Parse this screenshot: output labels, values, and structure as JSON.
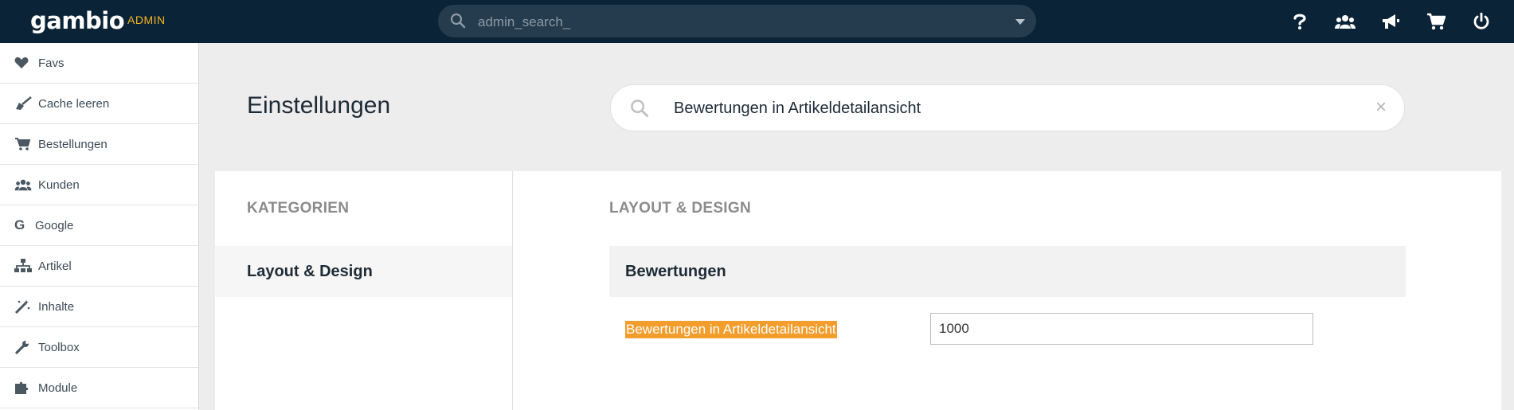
{
  "topbar": {
    "logo": "gambio",
    "badge": "ADMIN",
    "search_placeholder": "admin_search_",
    "icons": [
      "help-icon",
      "users-icon",
      "megaphone-icon",
      "cart-icon",
      "power-icon"
    ]
  },
  "sidebar": {
    "items": [
      {
        "label": "Favs",
        "icon": "heart-icon"
      },
      {
        "label": "Cache leeren",
        "icon": "broom-icon"
      },
      {
        "label": "Bestellungen",
        "icon": "cart-icon"
      },
      {
        "label": "Kunden",
        "icon": "users-icon"
      },
      {
        "label": "Google",
        "icon": "google-icon"
      },
      {
        "label": "Artikel",
        "icon": "sitemap-icon"
      },
      {
        "label": "Inhalte",
        "icon": "magic-icon"
      },
      {
        "label": "Toolbox",
        "icon": "wrench-icon"
      },
      {
        "label": "Module",
        "icon": "puzzle-icon"
      }
    ]
  },
  "header": {
    "title": "Einstellungen",
    "search_value": "Bewertungen in Artikeldetailansicht",
    "clear_symbol": "×"
  },
  "categories": {
    "heading": "KATEGORIEN",
    "items": [
      "Layout & Design"
    ]
  },
  "section": {
    "heading": "LAYOUT & DESIGN",
    "group": "Bewertungen",
    "setting_label": "Bewertungen in Artikeldetailansicht",
    "setting_value": "1000"
  },
  "colors": {
    "topbar": "#0b2336",
    "accent": "#f5b823",
    "highlight": "#f29d2c"
  }
}
